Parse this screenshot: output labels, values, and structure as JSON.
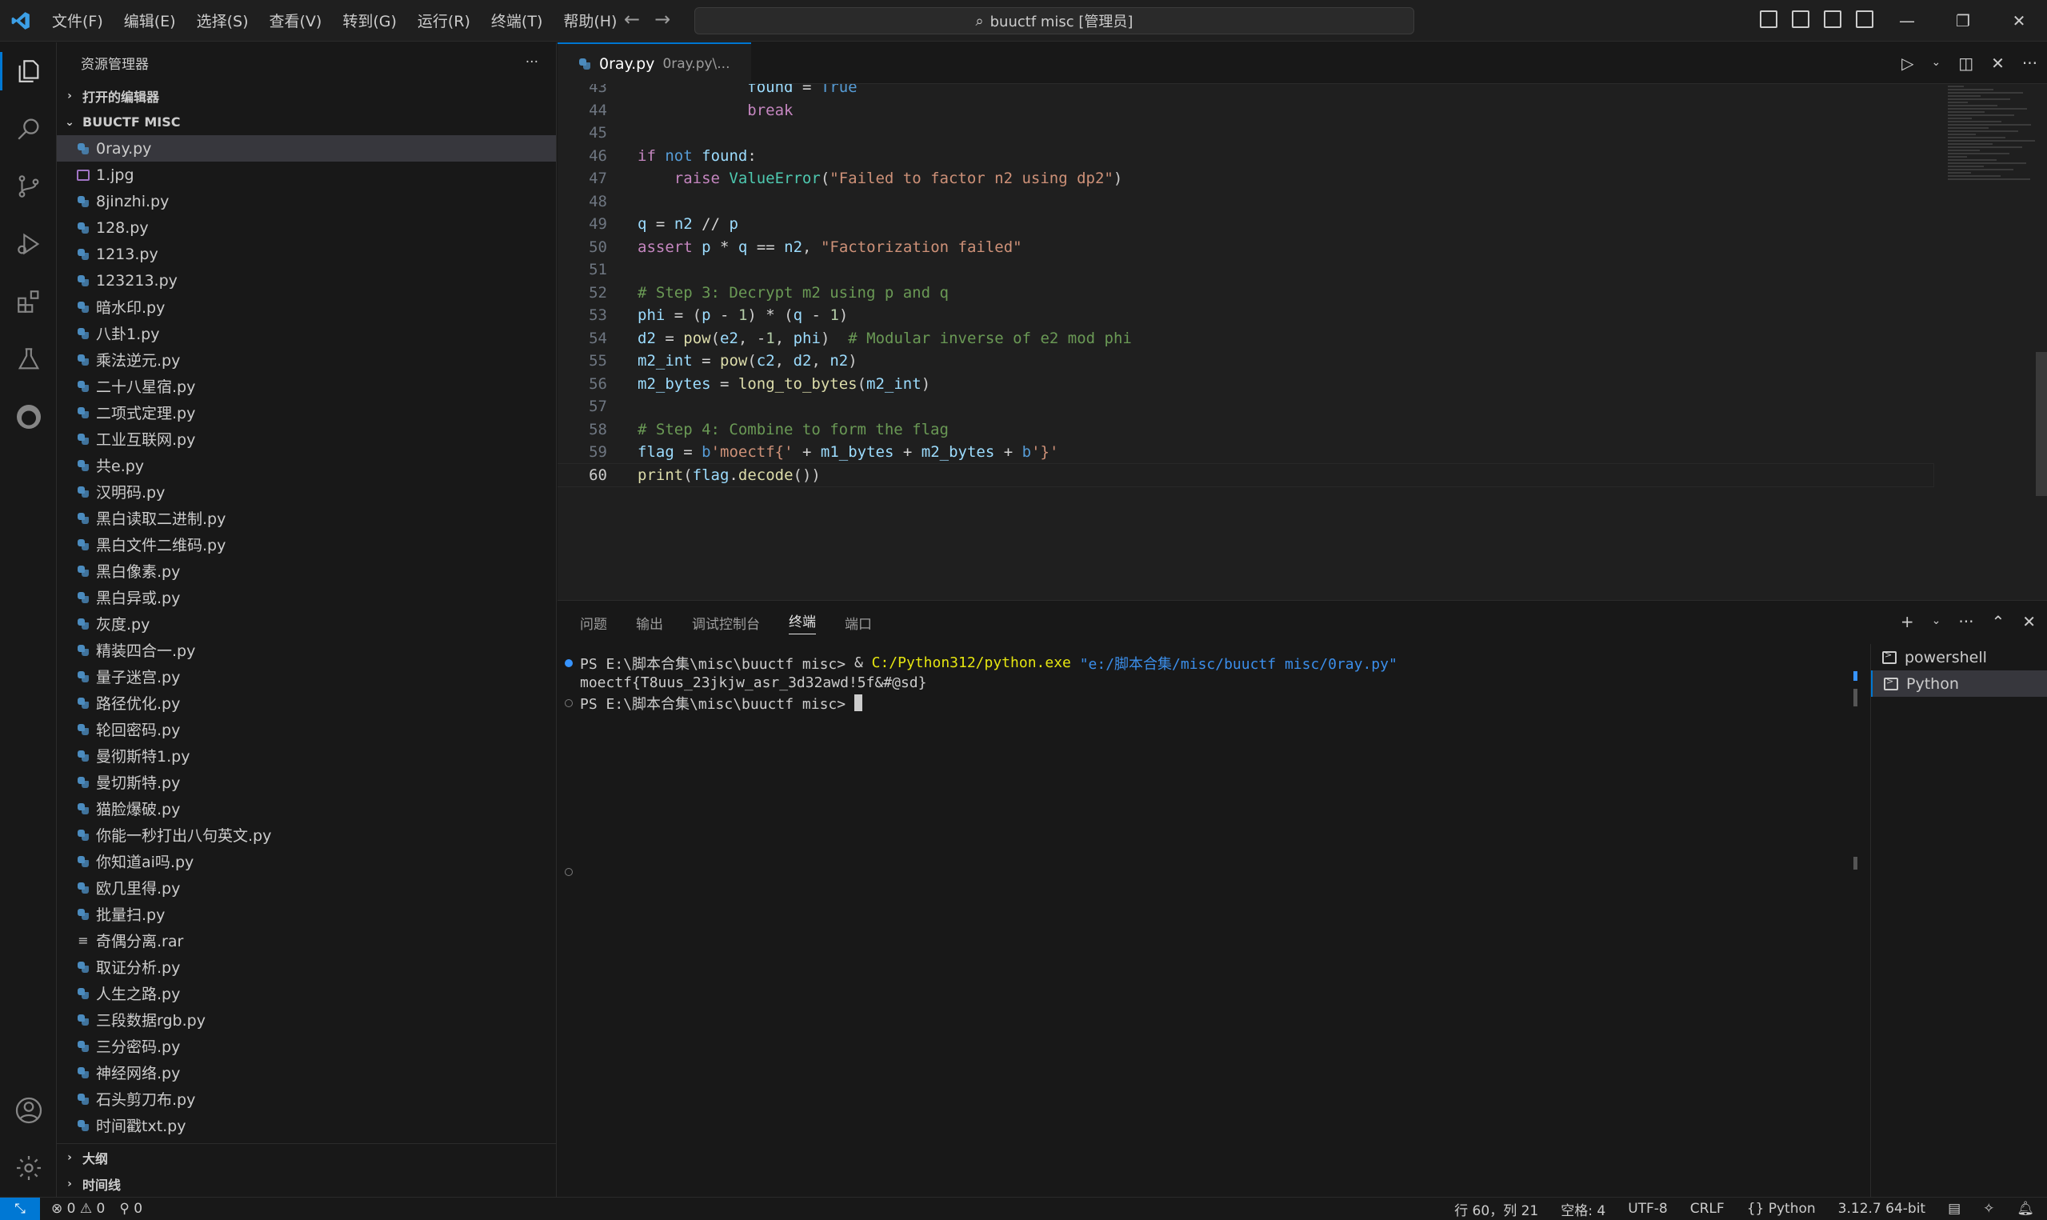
{
  "titlebar": {
    "menu": [
      "文件(F)",
      "编辑(E)",
      "选择(S)",
      "查看(V)",
      "转到(G)",
      "运行(R)",
      "终端(T)",
      "帮助(H)"
    ],
    "search_text": "buuctf misc [管理员]"
  },
  "sidebar": {
    "title": "资源管理器",
    "open_editors_label": "打开的编辑器",
    "workspace_label": "BUUCTF MISC",
    "files": [
      {
        "name": "0ray.py",
        "type": "py"
      },
      {
        "name": "1.jpg",
        "type": "img"
      },
      {
        "name": "8jinzhi.py",
        "type": "py"
      },
      {
        "name": "128.py",
        "type": "py"
      },
      {
        "name": "1213.py",
        "type": "py"
      },
      {
        "name": "123213.py",
        "type": "py"
      },
      {
        "name": "暗水印.py",
        "type": "py"
      },
      {
        "name": "八卦1.py",
        "type": "py"
      },
      {
        "name": "乘法逆元.py",
        "type": "py"
      },
      {
        "name": "二十八星宿.py",
        "type": "py"
      },
      {
        "name": "二项式定理.py",
        "type": "py"
      },
      {
        "name": "工业互联网.py",
        "type": "py"
      },
      {
        "name": "共e.py",
        "type": "py"
      },
      {
        "name": "汉明码.py",
        "type": "py"
      },
      {
        "name": "黑白读取二进制.py",
        "type": "py"
      },
      {
        "name": "黑白文件二维码.py",
        "type": "py"
      },
      {
        "name": "黑白像素.py",
        "type": "py"
      },
      {
        "name": "黑白异或.py",
        "type": "py"
      },
      {
        "name": "灰度.py",
        "type": "py"
      },
      {
        "name": "精装四合一.py",
        "type": "py"
      },
      {
        "name": "量子迷宫.py",
        "type": "py"
      },
      {
        "name": "路径优化.py",
        "type": "py"
      },
      {
        "name": "轮回密码.py",
        "type": "py"
      },
      {
        "name": "曼彻斯特1.py",
        "type": "py"
      },
      {
        "name": "曼切斯特.py",
        "type": "py"
      },
      {
        "name": "猫脸爆破.py",
        "type": "py"
      },
      {
        "name": "你能一秒打出八句英文.py",
        "type": "py"
      },
      {
        "name": "你知道ai吗.py",
        "type": "py"
      },
      {
        "name": "欧几里得.py",
        "type": "py"
      },
      {
        "name": "批量扫.py",
        "type": "py"
      },
      {
        "name": "奇偶分离.rar",
        "type": "rar"
      },
      {
        "name": "取证分析.py",
        "type": "py"
      },
      {
        "name": "人生之路.py",
        "type": "py"
      },
      {
        "name": "三段数据rgb.py",
        "type": "py"
      },
      {
        "name": "三分密码.py",
        "type": "py"
      },
      {
        "name": "神经网络.py",
        "type": "py"
      },
      {
        "name": "石头剪刀布.py",
        "type": "py"
      },
      {
        "name": "时间戳txt.py",
        "type": "py"
      }
    ],
    "outline_label": "大纲",
    "timeline_label": "时间线"
  },
  "editor": {
    "tab_name": "0ray.py",
    "tab_desc": "0ray.py\\...",
    "lines": [
      {
        "n": "43",
        "html": "            <span class='var'>found</span> <span class='op'>=</span> <span class='kw'>True</span>"
      },
      {
        "n": "44",
        "html": "            <span class='kw2'>break</span>"
      },
      {
        "n": "45",
        "html": ""
      },
      {
        "n": "46",
        "html": "<span class='kw2'>if</span> <span class='kw'>not</span> <span class='var'>found</span>:"
      },
      {
        "n": "47",
        "html": "    <span class='kw2'>raise</span> <span class='cls'>ValueError</span>(<span class='str'>\"Failed to factor n2 using dp2\"</span>)"
      },
      {
        "n": "48",
        "html": ""
      },
      {
        "n": "49",
        "html": "<span class='var'>q</span> <span class='op'>=</span> <span class='var'>n2</span> <span class='op'>//</span> <span class='var'>p</span>"
      },
      {
        "n": "50",
        "html": "<span class='kw2'>assert</span> <span class='var'>p</span> <span class='op'>*</span> <span class='var'>q</span> <span class='op'>==</span> <span class='var'>n2</span>, <span class='str'>\"Factorization failed\"</span>"
      },
      {
        "n": "51",
        "html": ""
      },
      {
        "n": "52",
        "html": "<span class='cm'># Step 3: Decrypt m2 using p and q</span>"
      },
      {
        "n": "53",
        "html": "<span class='var'>phi</span> <span class='op'>=</span> (<span class='var'>p</span> <span class='op'>-</span> <span class='num'>1</span>) <span class='op'>*</span> (<span class='var'>q</span> <span class='op'>-</span> <span class='num'>1</span>)"
      },
      {
        "n": "54",
        "html": "<span class='var'>d2</span> <span class='op'>=</span> <span class='fn'>pow</span>(<span class='var'>e2</span>, <span class='op'>-</span><span class='num'>1</span>, <span class='var'>phi</span>)  <span class='cm'># Modular inverse of e2 mod phi</span>"
      },
      {
        "n": "55",
        "html": "<span class='var'>m2_int</span> <span class='op'>=</span> <span class='fn'>pow</span>(<span class='var'>c2</span>, <span class='var'>d2</span>, <span class='var'>n2</span>)"
      },
      {
        "n": "56",
        "html": "<span class='var'>m2_bytes</span> <span class='op'>=</span> <span class='fn'>long_to_bytes</span>(<span class='var'>m2_int</span>)"
      },
      {
        "n": "57",
        "html": ""
      },
      {
        "n": "58",
        "html": "<span class='cm'># Step 4: Combine to form the flag</span>"
      },
      {
        "n": "59",
        "html": "<span class='var'>flag</span> <span class='op'>=</span> <span class='kw'>b</span><span class='str'>'moectf{'</span> <span class='op'>+</span> <span class='var'>m1_bytes</span> <span class='op'>+</span> <span class='var'>m2_bytes</span> <span class='op'>+</span> <span class='kw'>b</span><span class='str'>'}'</span>"
      },
      {
        "n": "60",
        "html": "<span class='fn'>print</span>(<span class='var'>flag</span>.<span class='fn'>decode</span>())"
      }
    ]
  },
  "panel": {
    "tabs": [
      "问题",
      "输出",
      "调试控制台",
      "终端",
      "端口"
    ],
    "active_tab": "终端",
    "terminal": {
      "prompt1": "PS E:\\脚本合集\\misc\\buuctf misc> ",
      "cmd_amp": "& ",
      "cmd_exe": "C:/Python312/python.exe",
      "cmd_arg": " \"e:/脚本合集/misc/buuctf misc/0ray.py\"",
      "output": "moectf{T8uus_23jkjw_asr_3d32awd!5f&#@sd}",
      "prompt2": "PS E:\\脚本合集\\misc\\buuctf misc> "
    },
    "terminals": [
      "powershell",
      "Python"
    ]
  },
  "statusbar": {
    "errors": "0",
    "warnings": "0",
    "ports": "0",
    "position": "行 60，列 21",
    "spaces": "空格: 4",
    "encoding": "UTF-8",
    "eol": "CRLF",
    "language": "Python",
    "interpreter": "3.12.7 64-bit"
  },
  "colors": {
    "accent": "#0078d4",
    "background": "#181818",
    "editor_bg": "#1f1f1f"
  }
}
